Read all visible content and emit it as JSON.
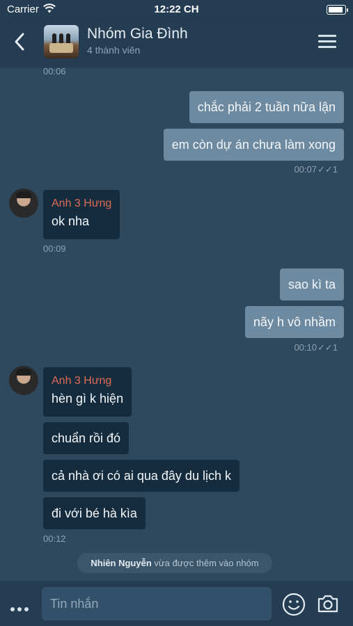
{
  "status": {
    "carrier": "Carrier",
    "time": "12:22 CH"
  },
  "header": {
    "title": "Nhóm Gia Đình",
    "subtitle": "4 thành viên"
  },
  "timeline": {
    "top_time": "00:06",
    "out1": {
      "m1": "chắc phải 2 tuần nữa lận",
      "m2": "em còn dự án chưa làm xong",
      "time": "00:07",
      "read": "1"
    },
    "in1": {
      "sender": "Anh 3 Hưng",
      "m1": "ok nha",
      "time": "00:09"
    },
    "out2": {
      "m1": "sao kì ta",
      "m2": "nãy h vô nhầm",
      "time": "00:10",
      "read": "1"
    },
    "in2": {
      "sender": "Anh 3 Hưng",
      "m1": "hèn gì k hiện",
      "m2": "chuẩn rồi đó",
      "m3": "cả nhà ơi có ai qua đây du lịch k",
      "m4": "đi với bé hà kìa",
      "time": "00:12"
    },
    "notice": {
      "name": "Nhiên Nguyễn",
      "text": " vừa được thêm vào nhóm"
    }
  },
  "composer": {
    "placeholder": "Tin nhắn"
  }
}
